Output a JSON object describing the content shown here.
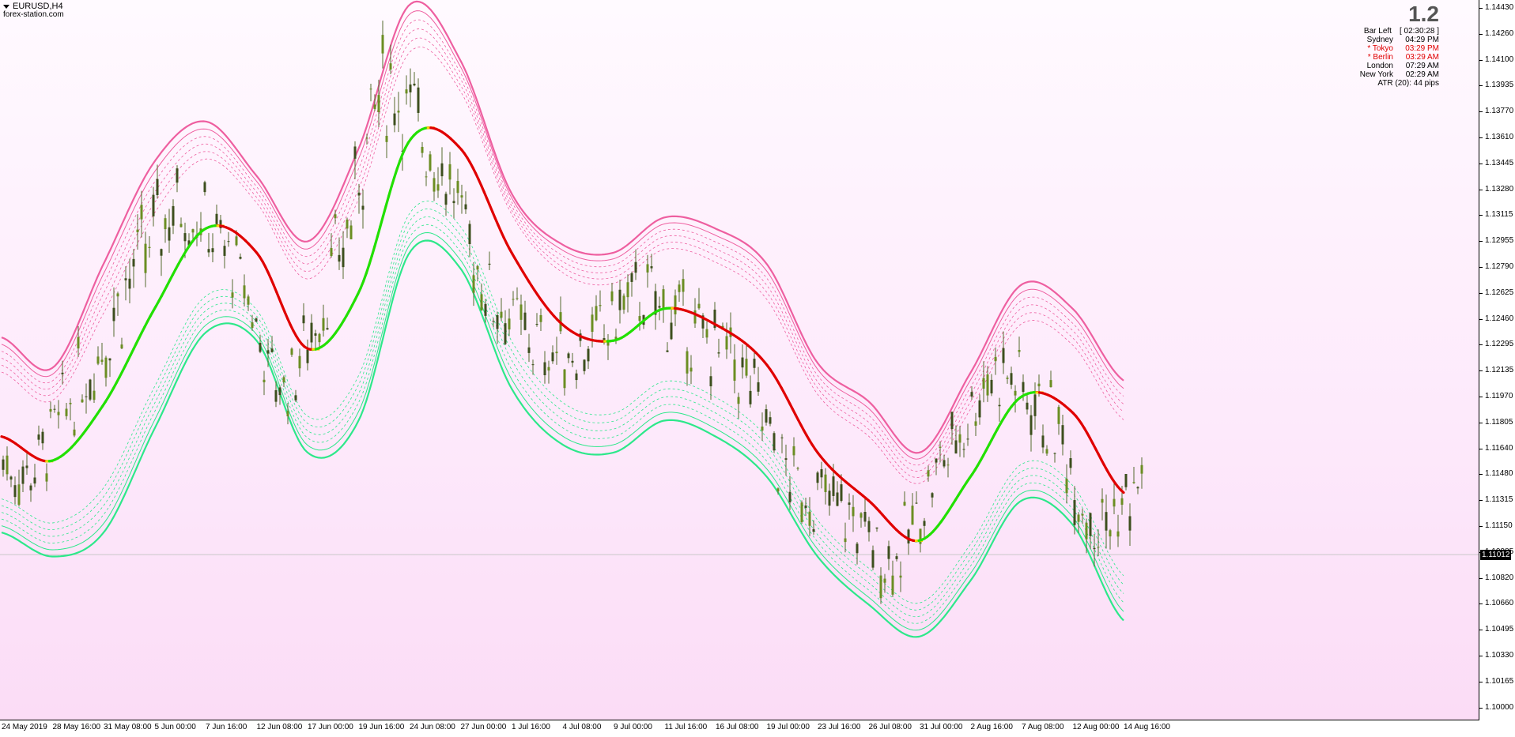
{
  "symbol": {
    "title": "EURUSD,H4",
    "site": "forex-station.com"
  },
  "info_panel": {
    "spread": "1.2",
    "rows": [
      {
        "label": "Bar Left",
        "value": "[ 02:30:28 ]",
        "highlight": false
      },
      {
        "label": "Sydney",
        "value": "04:29 PM",
        "highlight": false
      },
      {
        "label": "* Tokyo",
        "value": "03:29 PM",
        "highlight": true
      },
      {
        "label": "* Berlin",
        "value": "03:29 AM",
        "highlight": true
      },
      {
        "label": "London",
        "value": "07:29 AM",
        "highlight": false
      },
      {
        "label": "New York",
        "value": "02:29 AM",
        "highlight": false
      }
    ],
    "atr": "ATR (20): 44 pips"
  },
  "price_axis": {
    "ticks": [
      "1.14430",
      "1.14260",
      "1.14100",
      "1.13935",
      "1.13770",
      "1.13610",
      "1.13445",
      "1.13280",
      "1.13115",
      "1.12955",
      "1.12790",
      "1.12625",
      "1.12460",
      "1.12295",
      "1.12135",
      "1.11970",
      "1.11805",
      "1.11640",
      "1.11480",
      "1.11315",
      "1.11150",
      "1.10985",
      "1.10820",
      "1.10660",
      "1.10495",
      "1.10330",
      "1.10165",
      "1.10000"
    ],
    "current": "1.11012"
  },
  "time_axis": {
    "ticks": [
      "24 May 2019",
      "28 May 16:00",
      "31 May 08:00",
      "5 Jun 00:00",
      "7 Jun 16:00",
      "12 Jun 08:00",
      "17 Jun 00:00",
      "19 Jun 16:00",
      "24 Jun 08:00",
      "27 Jun 00:00",
      "1 Jul 16:00",
      "4 Jul 08:00",
      "9 Jul 00:00",
      "11 Jul 16:00",
      "16 Jul 08:00",
      "19 Jul 00:00",
      "23 Jul 16:00",
      "26 Jul 08:00",
      "31 Jul 00:00",
      "2 Aug 16:00",
      "7 Aug 08:00",
      "12 Aug 00:00",
      "14 Aug 16:00"
    ]
  },
  "colors": {
    "bull_line": "#22e000",
    "bear_line": "#e00000",
    "upper_band": "#ee5fa0",
    "lower_band": "#2de88a",
    "candle_body": "#556b2f",
    "turn_marker": "#ffd200"
  },
  "chart_data": {
    "type": "candlestick",
    "instrument": "EURUSD",
    "timeframe": "H4",
    "ylim": [
      1.1,
      1.1443
    ],
    "current_price": 1.11012,
    "centerline": [
      [
        "24 May 2019",
        1.1175
      ],
      [
        "28 May 16:00",
        1.116
      ],
      [
        "31 May 08:00",
        1.1195
      ],
      [
        "5 Jun 00:00",
        1.1255
      ],
      [
        "7 Jun 16:00",
        1.1305
      ],
      [
        "12 Jun 08:00",
        1.129
      ],
      [
        "17 Jun 00:00",
        1.123
      ],
      [
        "19 Jun 16:00",
        1.1265
      ],
      [
        "24 Jun 08:00",
        1.136
      ],
      [
        "27 Jun 00:00",
        1.1355
      ],
      [
        "1 Jul 16:00",
        1.129
      ],
      [
        "4 Jul 08:00",
        1.1245
      ],
      [
        "9 Jul 00:00",
        1.1235
      ],
      [
        "11 Jul 16:00",
        1.1255
      ],
      [
        "16 Jul 08:00",
        1.1245
      ],
      [
        "19 Jul 00:00",
        1.122
      ],
      [
        "23 Jul 16:00",
        1.1165
      ],
      [
        "26 Jul 08:00",
        1.1135
      ],
      [
        "31 Jul 00:00",
        1.111
      ],
      [
        "2 Aug 16:00",
        1.115
      ],
      [
        "7 Aug 08:00",
        1.12
      ],
      [
        "12 Aug 00:00",
        1.119
      ],
      [
        "14 Aug 16:00",
        1.114
      ]
    ],
    "band_upper": [
      1.1237,
      1.1218,
      1.1283,
      1.1347,
      1.1372,
      1.1338,
      1.1297,
      1.1355,
      1.1445,
      1.141,
      1.1327,
      1.1295,
      1.129,
      1.1312,
      1.1305,
      1.1283,
      1.1221,
      1.1197,
      1.1165,
      1.1215,
      1.127,
      1.1255,
      1.121
    ],
    "band_lower": [
      1.1115,
      1.11,
      1.1115,
      1.118,
      1.124,
      1.1235,
      1.1165,
      1.1185,
      1.129,
      1.128,
      1.1205,
      1.117,
      1.1165,
      1.1185,
      1.1175,
      1.115,
      1.11,
      1.107,
      1.105,
      1.1085,
      1.1135,
      1.112,
      1.106
    ]
  }
}
